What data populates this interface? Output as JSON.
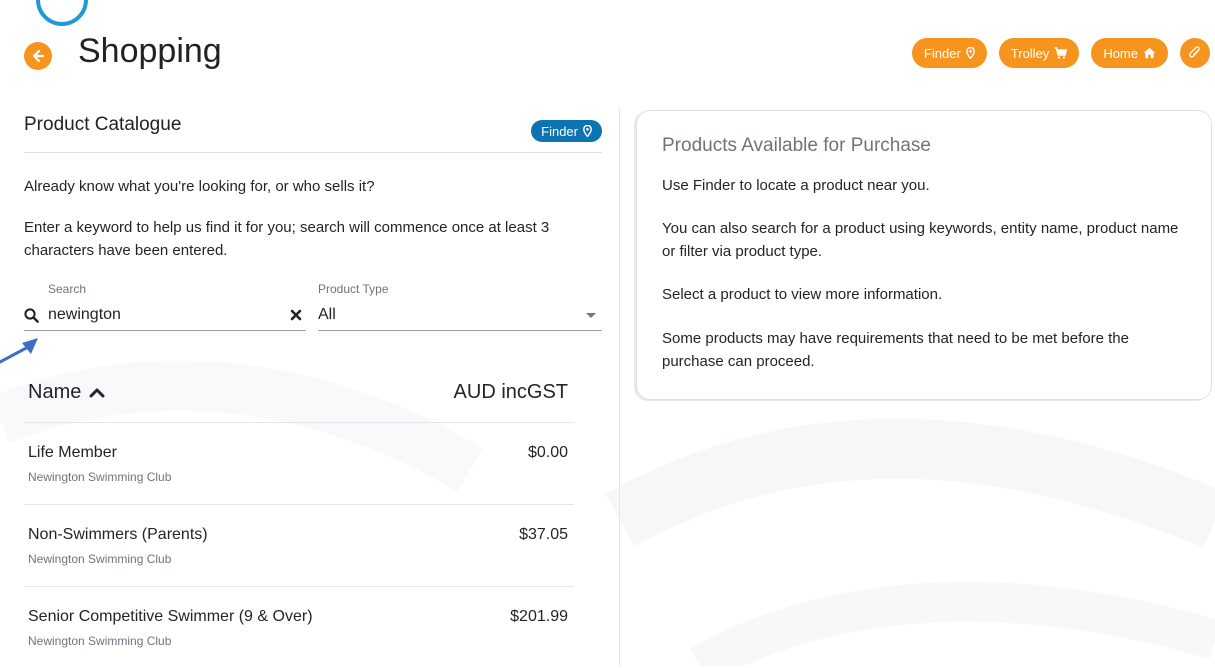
{
  "header": {
    "title": "Shopping",
    "nav": [
      {
        "label": "Finder",
        "icon": "map-marker-icon"
      },
      {
        "label": "Trolley",
        "icon": "cart-icon"
      },
      {
        "label": "Home",
        "icon": "home-icon"
      },
      {
        "label": "",
        "icon": "paperclip-icon"
      }
    ]
  },
  "catalogue": {
    "title": "Product Catalogue",
    "finder_badge": "Finder",
    "intro": "Already know what you're looking for, or who sells it?",
    "instructions": "Enter a keyword to help us find it for you; search will commence once at least 3 characters have been entered.",
    "search": {
      "label": "Search",
      "value": "newington"
    },
    "product_type": {
      "label": "Product Type",
      "value": "All"
    },
    "table": {
      "col_name": "Name",
      "col_price": "AUD incGST",
      "rows": [
        {
          "name": "Life Member",
          "entity": "Newington Swimming Club",
          "price": "$0.00"
        },
        {
          "name": "Non-Swimmers (Parents)",
          "entity": "Newington Swimming Club",
          "price": "$37.05"
        },
        {
          "name": "Senior Competitive Swimmer (9 & Over)",
          "entity": "Newington Swimming Club",
          "price": "$201.99"
        }
      ]
    }
  },
  "info_panel": {
    "title": "Products Available for Purchase",
    "p1": "Use Finder to locate a product near you.",
    "p2": "You can also search for a product using keywords, entity name, product name or filter via product type.",
    "p3": "Select a product to view more information.",
    "p4": "Some products may have requirements that need to be met before the purchase can proceed."
  },
  "colors": {
    "accent_orange": "#f7941d",
    "finder_blue": "#0d74b3",
    "annotation_arrow": "#3f6ec9"
  }
}
